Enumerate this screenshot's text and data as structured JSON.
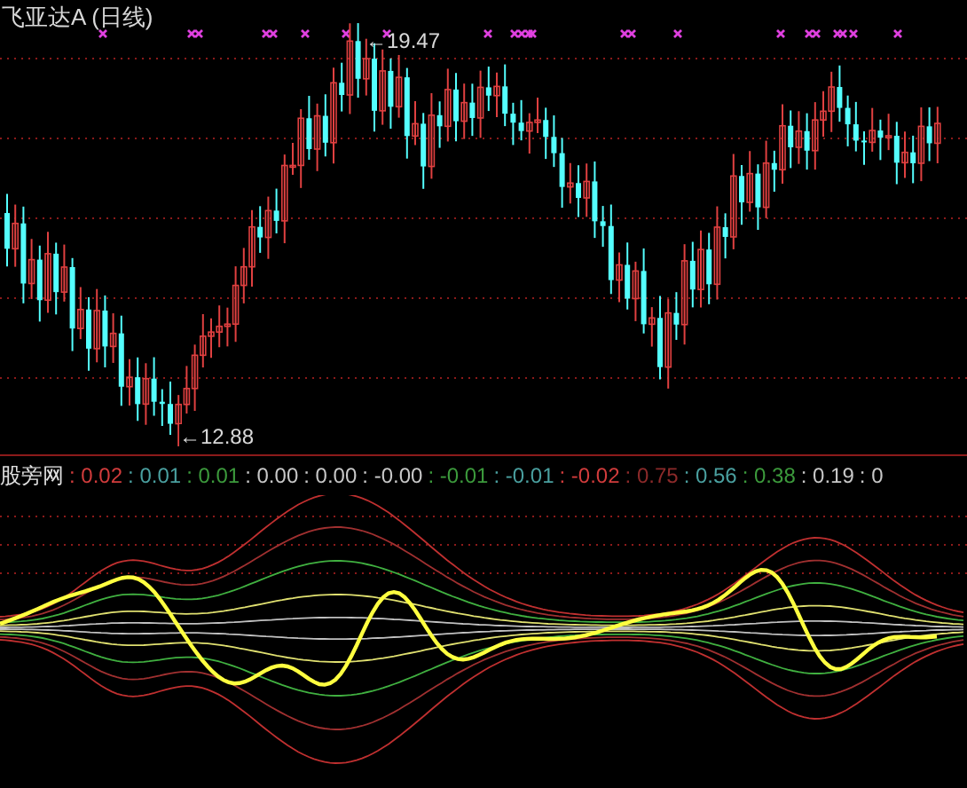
{
  "chart": {
    "title": "飞亚达A (日线)",
    "high_label": "←19.47",
    "low_label": "←12.88"
  },
  "indicator": {
    "name": "股旁网",
    "values": [
      {
        "text": ": 0.02",
        "color": "#d23c3c"
      },
      {
        "text": ": 0.01",
        "color": "#4aa0a0"
      },
      {
        "text": ": 0.01",
        "color": "#3c9a3c"
      },
      {
        "text": ": 0.00",
        "color": "#c8c8c8"
      },
      {
        "text": ": 0.00",
        "color": "#c8c8c8"
      },
      {
        "text": ": -0.00",
        "color": "#c8c8c8"
      },
      {
        "text": ": -0.01",
        "color": "#3c9a3c"
      },
      {
        "text": ": -0.01",
        "color": "#4aa0a0"
      },
      {
        "text": ": -0.02",
        "color": "#d23c3c"
      },
      {
        "text": ": 0.75",
        "color": "#8c2a2a"
      },
      {
        "text": ": 0.56",
        "color": "#4aa0a0"
      },
      {
        "text": ": 0.38",
        "color": "#3c9a3c"
      },
      {
        "text": ": 0.19",
        "color": "#c8c8c8"
      },
      {
        "text": ": 0",
        "color": "#c8c8c8"
      }
    ]
  }
}
